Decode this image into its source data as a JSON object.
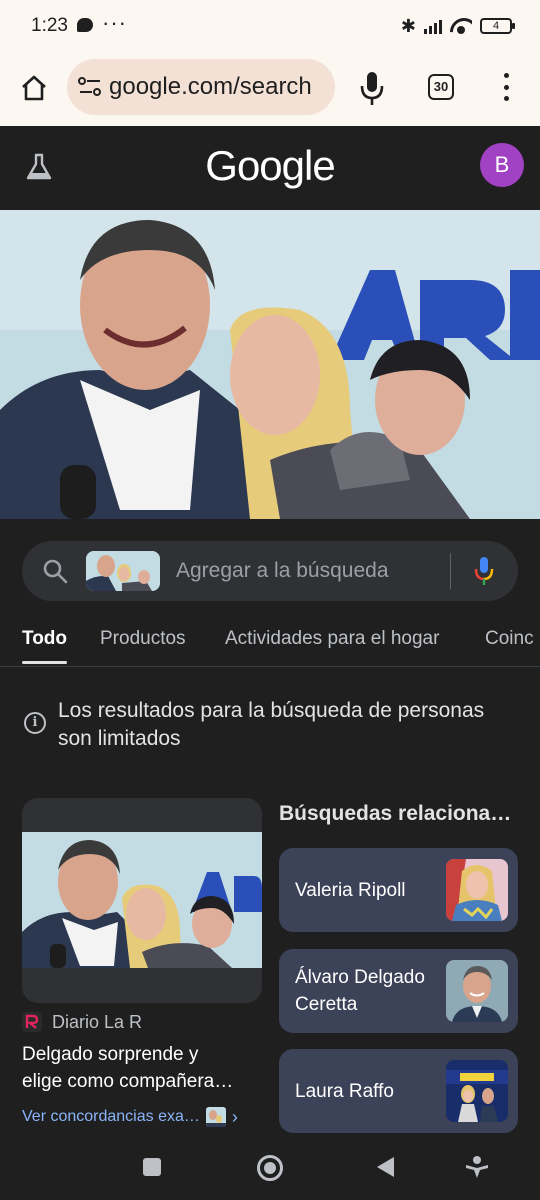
{
  "status_bar": {
    "time": "1:23",
    "dots": "···",
    "bluetooth": "✱",
    "battery": "4"
  },
  "browser": {
    "url": "google.com/search",
    "tab_count": "30"
  },
  "google": {
    "logo": "Google",
    "avatar_letter": "B",
    "avatar_color": "#a142c4"
  },
  "search": {
    "placeholder": "Agregar a la búsqueda"
  },
  "tabs": [
    {
      "label": "Todo",
      "active": true
    },
    {
      "label": "Productos",
      "active": false
    },
    {
      "label": "Actividades para el hogar",
      "active": false
    },
    {
      "label": "Coinc",
      "active": false
    }
  ],
  "notice": {
    "text": "Los resultados para la búsqueda de personas son limitados"
  },
  "result": {
    "source": "Diario La R",
    "title_line1": "Delgado sorprende y",
    "title_line2": "elige como compañera…",
    "exact_matches": "Ver concordancias exa…"
  },
  "related": {
    "heading": "Búsquedas relaciona…",
    "items": [
      {
        "label": "Valeria Ripoll"
      },
      {
        "label": "Álvaro Delgado Ceretta"
      },
      {
        "label": "Laura Raffo"
      }
    ]
  },
  "colors": {
    "background": "#1f1f1f",
    "browser_chrome": "#fdf7f2",
    "link": "#8ab4f8",
    "chip": "#3c4257"
  }
}
